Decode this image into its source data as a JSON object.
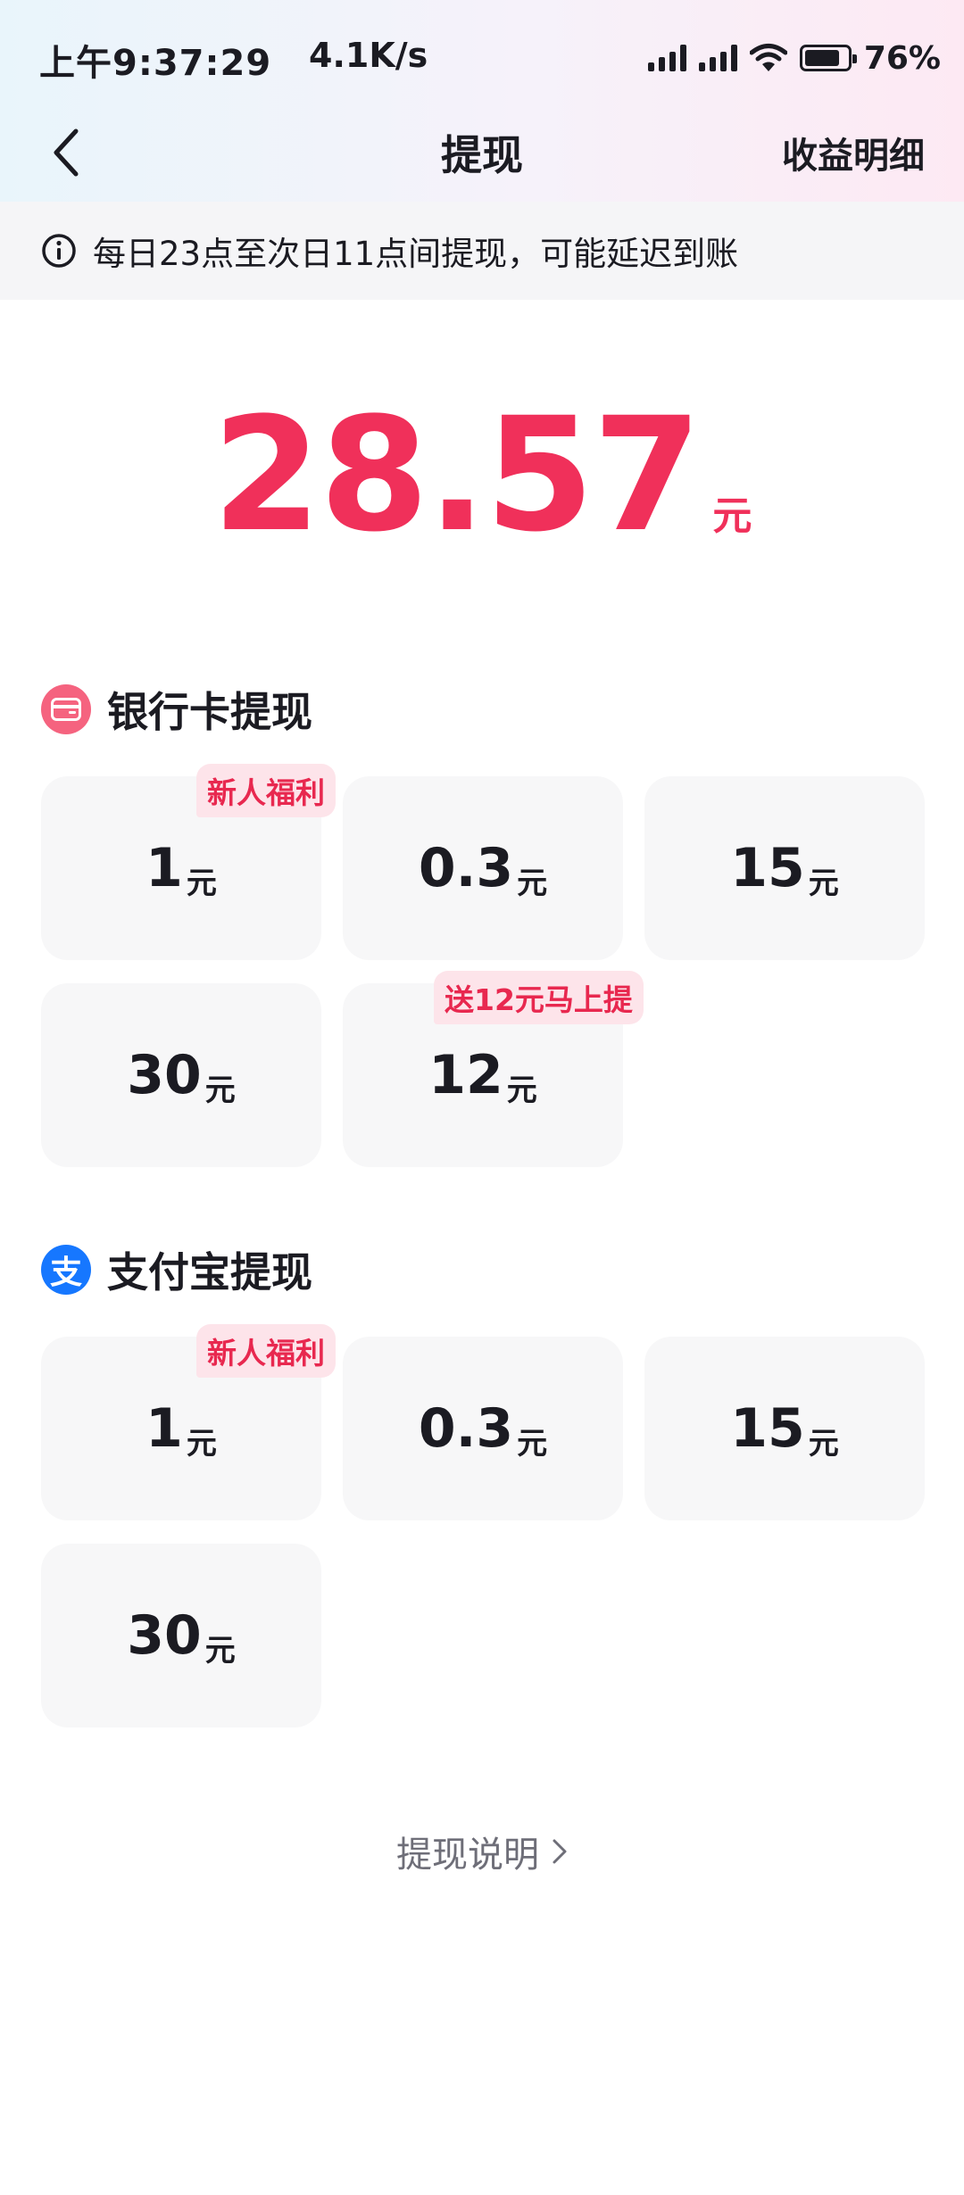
{
  "status": {
    "time": "上午9:37:29",
    "speed": "4.1K/s",
    "battery": "76%"
  },
  "nav": {
    "title": "提现",
    "detail": "收益明细"
  },
  "notice": {
    "text": "每日23点至次日11点间提现，可能延迟到账"
  },
  "balance": {
    "amount": "28.57",
    "unit": "元"
  },
  "bank": {
    "title": "银行卡提现",
    "options": [
      {
        "value": "1",
        "unit": "元",
        "tag": "新人福利"
      },
      {
        "value": "0.3",
        "unit": "元"
      },
      {
        "value": "15",
        "unit": "元"
      },
      {
        "value": "30",
        "unit": "元"
      },
      {
        "value": "12",
        "unit": "元",
        "tag": "送12元马上提"
      }
    ]
  },
  "alipay": {
    "title": "支付宝提现",
    "icon_char": "支",
    "options": [
      {
        "value": "1",
        "unit": "元",
        "tag": "新人福利"
      },
      {
        "value": "0.3",
        "unit": "元"
      },
      {
        "value": "15",
        "unit": "元"
      },
      {
        "value": "30",
        "unit": "元"
      }
    ]
  },
  "footer": {
    "explain": "提现说明"
  },
  "colors": {
    "accent": "#f0305a",
    "alipay_blue": "#1677ff",
    "tag_bg": "#fde4ea"
  }
}
